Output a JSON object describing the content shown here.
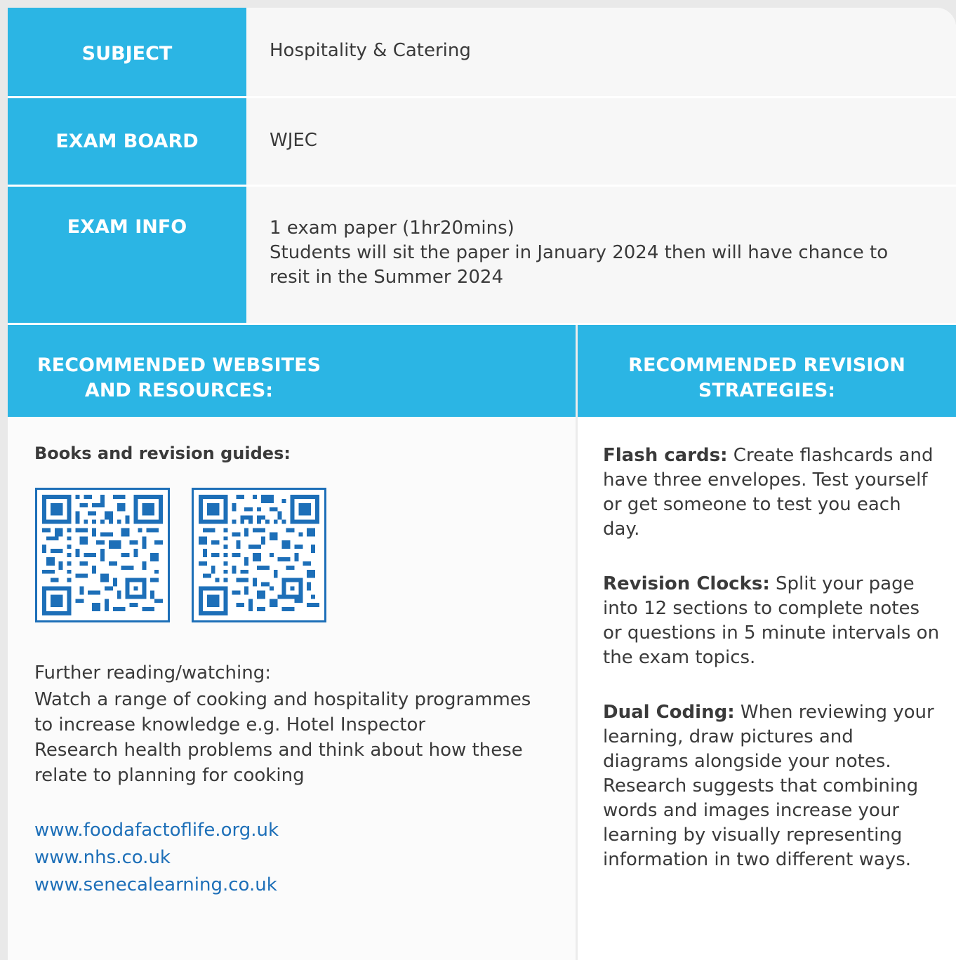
{
  "info_rows": {
    "subject_label": "SUBJECT",
    "subject_value": "Hospitality & Catering",
    "board_label": "EXAM BOARD",
    "board_value": "WJEC",
    "info_label": "EXAM INFO",
    "info_line1": "1 exam paper (1hr20mins)",
    "info_line2": "Students will sit the paper in January 2024 then will have chance to resit in the Summer 2024"
  },
  "left_section": {
    "header_line1": "RECOMMENDED WEBSITES",
    "header_line2": "AND RESOURCES:",
    "books_heading": "Books and revision guides:",
    "further_heading": "Further reading/watching:",
    "further_line1": "Watch a range of cooking and hospitality programmes to increase knowledge e.g. Hotel Inspector",
    "further_line2": "Research health problems and think about how these relate to planning for cooking",
    "links": [
      "www.foodafactoflife.org.uk",
      "www.nhs.co.uk",
      "www.senecalearning.co.uk"
    ]
  },
  "right_section": {
    "header_line1": "RECOMMENDED REVISION",
    "header_line2": "STRATEGIES:",
    "strategies": [
      {
        "title": "Flash cards:",
        "text": " Create flashcards and have three envelopes. Test yourself or get someone to test you each day."
      },
      {
        "title": "Revision Clocks:",
        "text": " Split your page into 12 sections to complete notes or questions in 5 minute intervals on the exam topics."
      },
      {
        "title": "Dual Coding:",
        "text": " When reviewing your learning, draw pictures and diagrams alongside your notes. Research suggests that combining words and images increase your learning by visually representing information in two different ways."
      }
    ]
  },
  "colors": {
    "accent": "#2bb5e4",
    "link": "#1d6fb8",
    "text": "#3a3a3a"
  },
  "icons": [
    "qr-code-icon"
  ]
}
